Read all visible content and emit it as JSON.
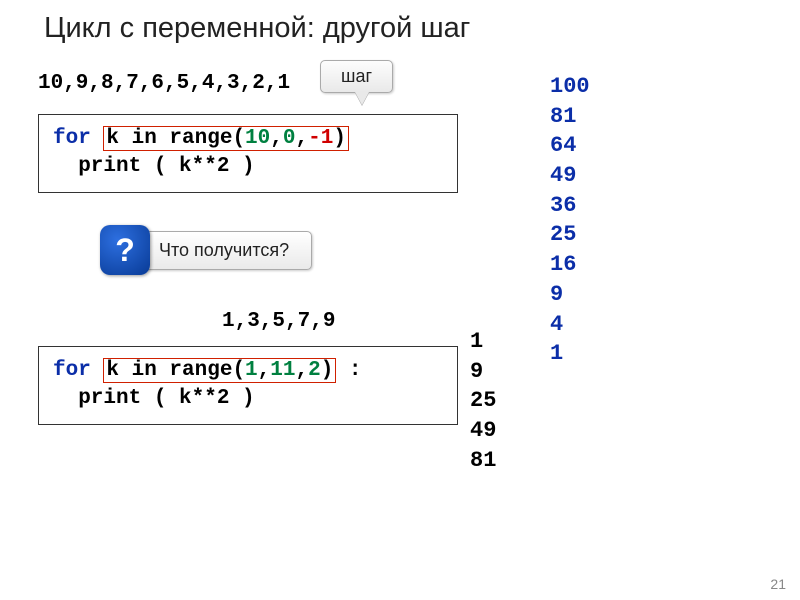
{
  "title": "Цикл с переменной: другой шаг",
  "seq1": "10,9,8,7,6,5,4,3,2,1",
  "seq2": "1,3,5,7,9",
  "step_label": "шаг",
  "question_mark": "?",
  "question_text": "Что получится?",
  "code1": {
    "for": "for",
    "var_in_range": "k in range(",
    "a": "10",
    "c1": ",",
    "b": "0",
    "c2": ",",
    "step": "-1",
    "close": ")",
    "line2": "  print ( k**2 )"
  },
  "code2": {
    "for": "for",
    "var_in_range": "k in range(",
    "a": "1",
    "c1": ",",
    "b": "11",
    "c2": ",",
    "step": "2",
    "close": ")",
    "colon": " :",
    "line2": "  print ( k**2 )"
  },
  "output1": [
    "100",
    "81",
    "64",
    "49",
    "36",
    "25",
    "16",
    "9",
    "4",
    "1"
  ],
  "output2": [
    "1",
    "9",
    "25",
    "49",
    "81"
  ],
  "page_number": "21"
}
